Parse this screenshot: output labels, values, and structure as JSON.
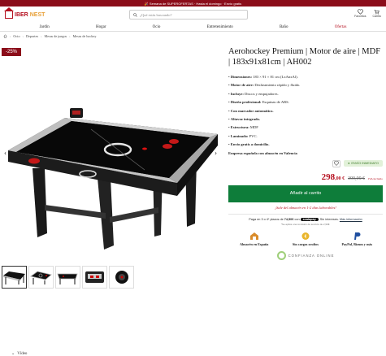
{
  "topbar": {
    "text": "🎉 Semana de SUPEROFERTAS · Hasta el domingo · Envío gratis"
  },
  "brand": {
    "name_part1": "IBER",
    "name_part2": "NEST"
  },
  "search": {
    "placeholder": "¿Qué estás buscando?"
  },
  "header_icons": [
    {
      "label": "Favoritos",
      "icon": "heart-icon"
    },
    {
      "label": "Carrito",
      "icon": "cart-icon"
    }
  ],
  "nav": {
    "items": [
      "Jardín",
      "Hogar",
      "Ocio",
      "Entretenimiento",
      "Baño",
      "Ofertas"
    ]
  },
  "breadcrumb": [
    "Ocio",
    "Deportes",
    "Mesas de juegos",
    "Mesas de hockey"
  ],
  "product": {
    "badge": "-25%",
    "title": "Aerohockey Premium | Motor de aire | MDF | 183x91x81cm | AH002",
    "specs": [
      {
        "label": "Dimensiones:",
        "value": "183 × 91 × 81 cm (LxAnxAl)."
      },
      {
        "label": "Motor de aire:",
        "value": "Deslizamiento rápido y fluido."
      },
      {
        "label": "Incluye:",
        "value": "Discos y empujadores."
      },
      {
        "label": "Diseño profesional:",
        "value": "Esquinas de ABS."
      },
      {
        "label": "Con marcador automático.",
        "value": ""
      },
      {
        "label": "Altavoz integrado.",
        "value": ""
      },
      {
        "label": "Estructura:",
        "value": "MDF"
      },
      {
        "label": "Laminado:",
        "value": "PVC."
      },
      {
        "label": "Envío gratis a domicilio.",
        "value": ""
      }
    ],
    "ship_note": "Empresa española con almacén en Valencia",
    "stock": "ENVÍO INMEDIATO",
    "price": "298",
    "price_cents": ",00 €",
    "old_price": "399,99 €",
    "iva": "IVA incluido",
    "cart_label": "Añadir al carrito",
    "last_units": "¡Sale del almacén en 1-2 días laborables!",
    "pay_text_1": "Paga en 3 o 4* plazos de",
    "pay_amount": "74,50€",
    "pay_text_2": "con",
    "pay_brand": "scalapay",
    "pay_text_3": ". Sin intereses.",
    "pay_link": "Más información",
    "pay_note": "*Se aplica una comisión de servicio de 2,99€.",
    "features": [
      {
        "label": "Almacén en España",
        "icon": "warehouse-icon"
      },
      {
        "label": "Sin cargos ocultos",
        "icon": "no-fees-icon"
      },
      {
        "label": "PayPal, Bizum y más",
        "icon": "paypal-icon"
      }
    ],
    "trust": "CONFIANZA ONLINE",
    "video_label": "Vídeo"
  },
  "colors": {
    "brand": "#b5101f",
    "topbar": "#8b0d1a",
    "cart": "#0e7d3a",
    "stock_bg": "#e2f1d9"
  }
}
